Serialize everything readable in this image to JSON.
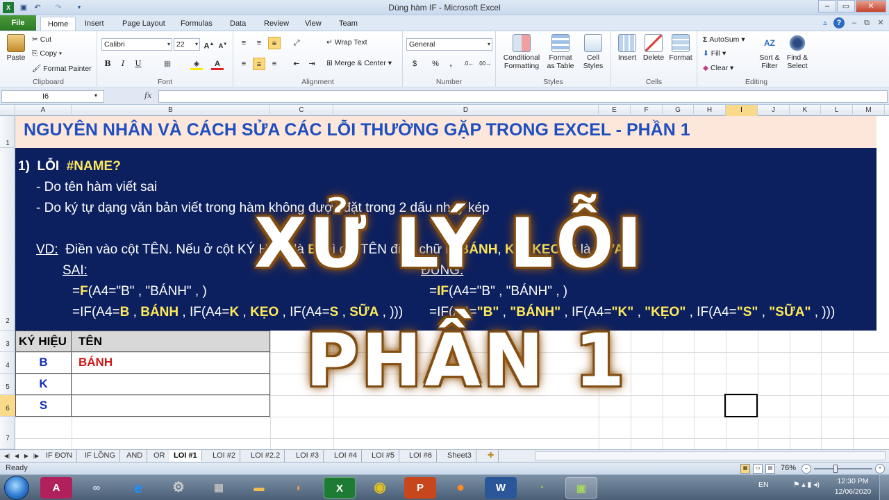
{
  "window": {
    "title": "Dùng hàm IF  -  Microsoft Excel"
  },
  "ribbon_tabs": [
    "File",
    "Home",
    "Insert",
    "Page Layout",
    "Formulas",
    "Data",
    "Review",
    "View",
    "Team"
  ],
  "clipboard": {
    "paste": "Paste",
    "cut": "Cut",
    "copy": "Copy",
    "format_painter": "Format Painter",
    "label": "Clipboard"
  },
  "font": {
    "name": "Calibri",
    "size": "22",
    "bold": "B",
    "italic": "I",
    "underline": "U",
    "label": "Font"
  },
  "alignment": {
    "wrap": "Wrap Text",
    "merge": "Merge & Center",
    "label": "Alignment"
  },
  "number": {
    "format": "General",
    "currency": "$",
    "percent": "%",
    "comma": ",",
    "label": "Number"
  },
  "styles": {
    "conditional": "Conditional Formatting",
    "format_table": "Format as Table",
    "cell_styles": "Cell Styles",
    "label": "Styles"
  },
  "cells_grp": {
    "insert": "Insert",
    "delete": "Delete",
    "format": "Format",
    "label": "Cells"
  },
  "editing": {
    "autosum": "AutoSum",
    "fill": "Fill",
    "clear": "Clear",
    "sort": "Sort & Filter",
    "find": "Find & Select",
    "label": "Editing"
  },
  "formula_bar": {
    "name_box": "I6",
    "fx": "fx",
    "formula": ""
  },
  "columns": [
    "A",
    "B",
    "C",
    "D",
    "E",
    "F",
    "G",
    "H",
    "I",
    "J",
    "K",
    "L",
    "M"
  ],
  "rows": [
    "1",
    "2",
    "3",
    "4",
    "5",
    "6",
    "7"
  ],
  "sheet": {
    "heading": "NGUYÊN NHÂN VÀ CÁCH SỬA CÁC LỖI THƯỜNG GẶP TRONG EXCEL - PHẦN 1",
    "l1_num": "1)",
    "l1_word": "LỖI",
    "l1_err": "#NAME?",
    "l2": "- Do tên hàm viết sai",
    "l3": "- Do ký tự dạng văn bản viết trong hàm không được đặt trong 2 dấu nháy kép",
    "vd_label": "VD:",
    "vd_a": "Điền vào cột TÊN. Nếu ở cột KÝ HIỆU là ",
    "vd_b": "B",
    "vd_c": " thì cột TÊN điền chữ là ",
    "vd_d": "BÁNH",
    "vd_e": ", ",
    "vd_f": "K",
    "vd_g": " là ",
    "vd_h": "KẸO",
    "vd_i": ", ",
    "vd_j": "S",
    "vd_k": " là ",
    "vd_l": "SỮA",
    "vd_m": ".",
    "sai": "SAI:",
    "dung": "ĐÚNG:",
    "f1_eq": "=",
    "f1_fn": "F",
    "f1_rest": "(A4=\"B\" , \"BÁNH\" , )",
    "f2_a": "=IF(A4=",
    "f2_b": "B",
    "f2_c": " , ",
    "f2_d": "BÁNH",
    "f2_e": " , IF(A4=",
    "f2_f": "K",
    "f2_g": " , ",
    "f2_h": "KẸO",
    "f2_i": " , IF(A4=",
    "f2_j": "S",
    "f2_k": " , ",
    "f2_l": "SỮA",
    "f2_m": " , )))",
    "g1_eq": "=",
    "g1_fn": "IF",
    "g1_rest": "(A4=\"B\" , \"BÁNH\" , )",
    "g2_a": "=IF(A4=",
    "g2_b": "\"B\"",
    "g2_c": " , ",
    "g2_d": "\"BÁNH\"",
    "g2_e": " , IF(A4=",
    "g2_f": "\"K\"",
    "g2_g": " , ",
    "g2_h": "\"KẸO\"",
    "g2_i": " , IF(A4=",
    "g2_j": "\"S\"",
    "g2_k": " , ",
    "g2_l": "\"SỮA\"",
    "g2_m": " , )))",
    "th_code": "KÝ HIỆU",
    "th_name": "TÊN",
    "rows": [
      {
        "code": "B",
        "name": "BÁNH"
      },
      {
        "code": "K",
        "name": ""
      },
      {
        "code": "S",
        "name": ""
      }
    ]
  },
  "overlay": {
    "line1": "XỬ LÝ LỖI",
    "line2": "PHẦN 1"
  },
  "sheet_tabs": [
    "IF ĐƠN",
    "IF LỒNG",
    "AND",
    "OR",
    "LOI #1",
    "LOI #2",
    "LOI #2.2",
    "LOI #3",
    "LOI #4",
    "LOI #5",
    "LOI #6",
    "Sheet3"
  ],
  "active_sheet": "LOI #1",
  "status": {
    "ready": "Ready",
    "zoom": "76%"
  },
  "taskbar": {
    "lang": "EN",
    "time": "12:30 PM",
    "date": "12/06/2020"
  }
}
